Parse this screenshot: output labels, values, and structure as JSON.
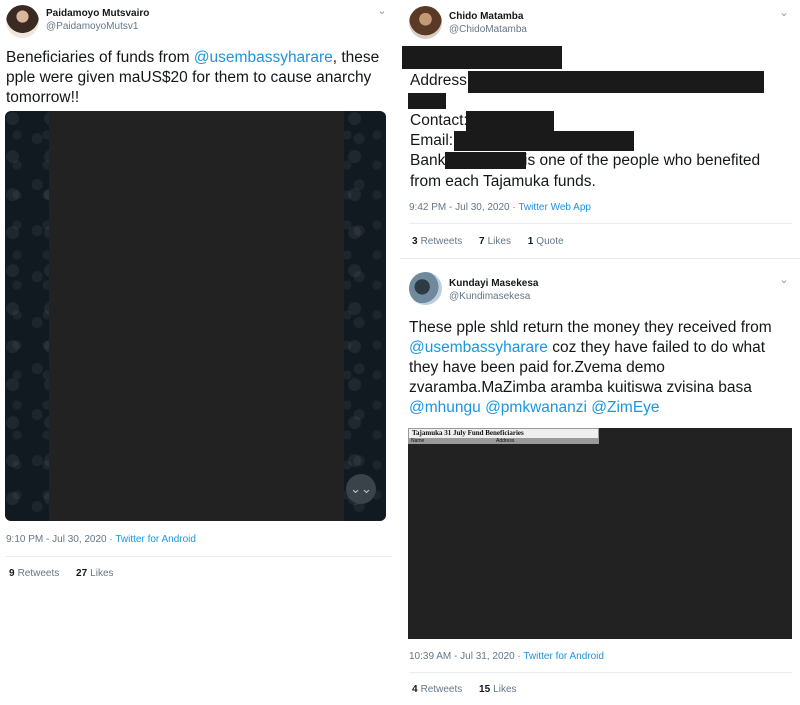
{
  "tweets": [
    {
      "name": "Paidamoyo Mutsvairo",
      "handle": "@PaidamoyoMutsv1",
      "text_before": "Beneficiaries of funds from ",
      "mention_1": "@usembassyharare",
      "text_after": ", these pple were given maUS$20 for them to cause anarchy tomorrow!!",
      "timestamp": "9:10 PM - Jul 30, 2020",
      "separator": " · ",
      "source": "Twitter for Android",
      "retweets_count": "9",
      "retweets_label": "Retweets",
      "likes_count": "27",
      "likes_label": "Likes"
    },
    {
      "name": "Chido Matamba",
      "handle": "@ChidoMatamba",
      "address_label": "Address:",
      "contact_label": "Contact:",
      "email_label": "Email:",
      "bank_label": "Bank:",
      "bank_suffix": " is one of the people who benefited",
      "line_last": "from each Tajamuka funds.",
      "timestamp": "9:42 PM - Jul 30, 2020",
      "separator": " · ",
      "source": "Twitter Web App",
      "retweets_count": "3",
      "retweets_label": "Retweets",
      "likes_count": "7",
      "likes_label": "Likes",
      "quotes_count": "1",
      "quotes_label": "Quote"
    },
    {
      "name": "Kundayi Masekesa",
      "handle": "@Kundimasekesa",
      "text_1": "These pple shld return the money they received from",
      "mention_1": "@usembassyharare",
      "text_2": " coz they have failed to do what they have been paid for.Zvema demo zvaramba.MaZimba aramba kuitiswa zvisina basa",
      "mention_2": "@mhungu",
      "mention_3": "@pmkwananzi",
      "mention_4": "@ZimEye",
      "doc_title": "Tajamuka 31 July Fund Beneficiaries",
      "doc_col_1": "Name",
      "doc_col_2": "Address",
      "timestamp": "10:39 AM - Jul 31, 2020",
      "separator": " · ",
      "source": "Twitter for Android",
      "retweets_count": "4",
      "retweets_label": "Retweets",
      "likes_count": "15",
      "likes_label": "Likes"
    }
  ],
  "icons": {
    "caret": "⌄",
    "scroll_down": "⌄⌄"
  }
}
